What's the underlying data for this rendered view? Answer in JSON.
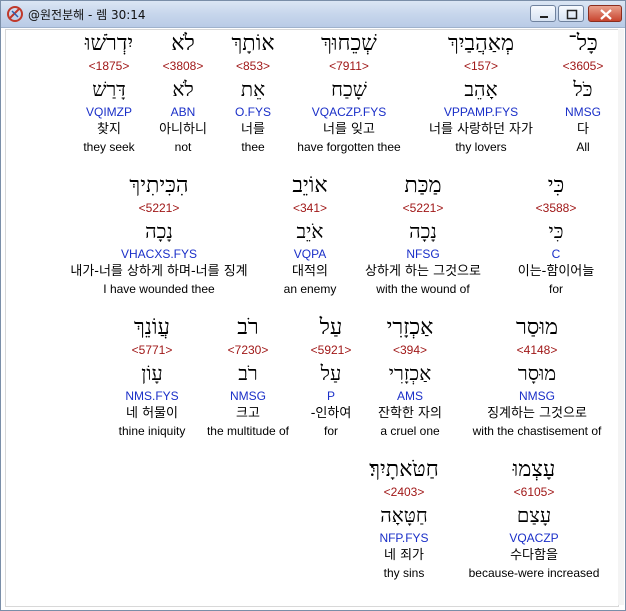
{
  "window": {
    "title": "@원전분해 - 렘 30:14",
    "controls": {
      "minimize": "minimize",
      "maximize": "maximize",
      "close": "close"
    }
  },
  "rows": [
    {
      "words": [
        {
          "heb": "כָּל־",
          "strong": "<3605>",
          "lemma": "כֹּל",
          "morph": "NMSG",
          "kor": "다",
          "eng": "All"
        },
        {
          "heb": "מְאַהֲבַיִךְ",
          "strong": "<157>",
          "lemma": "אָהֵב",
          "morph": "VPPAMP.FYS",
          "kor": "너를 사랑하던 자가",
          "eng": "thy lovers"
        },
        {
          "heb": "שְׁכֵחוּךְ",
          "strong": "<7911>",
          "lemma": "שָׁכַח",
          "morph": "VQACZP.FYS",
          "kor": "너를 잊고",
          "eng": "have forgotten thee"
        },
        {
          "heb": "אוֹתָךְ",
          "strong": "<853>",
          "lemma": "אֵת",
          "morph": "O.FYS",
          "kor": "너를",
          "eng": "thee"
        },
        {
          "heb": "לֹא",
          "strong": "<3808>",
          "lemma": "לֹא",
          "morph": "ABN",
          "kor": "아니하니",
          "eng": "not"
        },
        {
          "heb": "יִדְרֹשׁוּ",
          "strong": "<1875>",
          "lemma": "דָּרַשׁ",
          "morph": "VQIMZP",
          "kor": "찾지",
          "eng": "they seek"
        }
      ]
    },
    {
      "words": [
        {
          "heb": "כִּי",
          "strong": "<3588>",
          "lemma": "כִּי",
          "morph": "C",
          "kor": "이는-함이어늘",
          "eng": "for"
        },
        {
          "heb": "מַכַּת",
          "strong": "<5221>",
          "lemma": "נָכָה",
          "morph": "NFSG",
          "kor": "상하게 하는 그것으로",
          "eng": "with the wound of"
        },
        {
          "heb": "אוֹיֵב",
          "strong": "<341>",
          "lemma": "אֹיֵב",
          "morph": "VQPA",
          "kor": "대적의",
          "eng": "an enemy"
        },
        {
          "heb": "הִכִּיתִיךְ",
          "strong": "<5221>",
          "lemma": "נָכָה",
          "morph": "VHACXS.FYS",
          "kor": "내가-너를 상하게 하며-너를 징계",
          "eng": "I have wounded thee"
        }
      ]
    },
    {
      "words": [
        {
          "heb": "מוּסַר",
          "strong": "<4148>",
          "lemma": "מוּסָר",
          "morph": "NMSG",
          "kor": "징계하는 그것으로",
          "eng": "with the chastisement of"
        },
        {
          "heb": "אַכְזָרִי",
          "strong": "<394>",
          "lemma": "אַכְזָרִי",
          "morph": "AMS",
          "kor": "잔학한 자의",
          "eng": "a cruel one"
        },
        {
          "heb": "עַל",
          "strong": "<5921>",
          "lemma": "עַל",
          "morph": "P",
          "kor": "-인하여",
          "eng": "for"
        },
        {
          "heb": "רֹב",
          "strong": "<7230>",
          "lemma": "רֹב",
          "morph": "NMSG",
          "kor": "크고",
          "eng": "the multitude of"
        },
        {
          "heb": "עֲוֹנֵךְ",
          "strong": "<5771>",
          "lemma": "עָוֹן",
          "morph": "NMS.FYS",
          "kor": "네 허물이",
          "eng": "thine iniquity"
        }
      ]
    },
    {
      "words": [
        {
          "heb": "עָצְמוּ",
          "strong": "<6105>",
          "lemma": "עָצַם",
          "morph": "VQACZP",
          "kor": "수다함을",
          "eng": "because-were increased"
        },
        {
          "heb": "חַטֹּאתָיִךְ׃",
          "strong": "<2403>",
          "lemma": "חַטָּאָה",
          "morph": "NFP.FYS",
          "kor": "네 죄가",
          "eng": "thy sins"
        }
      ]
    }
  ]
}
